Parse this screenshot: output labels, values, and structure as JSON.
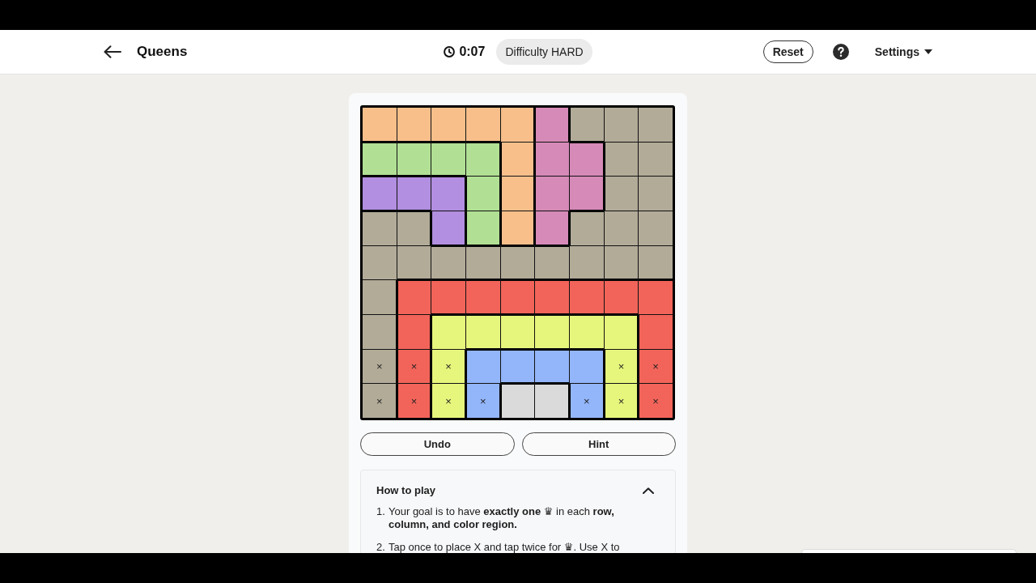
{
  "header": {
    "title": "Queens",
    "timer": "0:07",
    "difficulty": "Difficulty HARD",
    "reset": "Reset",
    "settings": "Settings"
  },
  "board": {
    "rows": [
      [
        {
          "color": "#f9bf8b"
        },
        {
          "color": "#f9bf8b"
        },
        {
          "color": "#f9bf8b"
        },
        {
          "color": "#f9bf8b"
        },
        {
          "color": "#f9bf8b"
        },
        {
          "color": "#d68ab8"
        },
        {
          "color": "#b2ab98"
        },
        {
          "color": "#b2ab98"
        },
        {
          "color": "#b2ab98"
        }
      ],
      [
        {
          "color": "#b1e095"
        },
        {
          "color": "#b1e095"
        },
        {
          "color": "#b1e095"
        },
        {
          "color": "#b1e095"
        },
        {
          "color": "#f9bf8b"
        },
        {
          "color": "#d68ab8"
        },
        {
          "color": "#d68ab8"
        },
        {
          "color": "#b2ab98"
        },
        {
          "color": "#b2ab98"
        }
      ],
      [
        {
          "color": "#b28fe0"
        },
        {
          "color": "#b28fe0"
        },
        {
          "color": "#b28fe0"
        },
        {
          "color": "#b1e095"
        },
        {
          "color": "#f9bf8b"
        },
        {
          "color": "#d68ab8"
        },
        {
          "color": "#d68ab8"
        },
        {
          "color": "#b2ab98"
        },
        {
          "color": "#b2ab98"
        }
      ],
      [
        {
          "color": "#b2ab98"
        },
        {
          "color": "#b2ab98"
        },
        {
          "color": "#b28fe0"
        },
        {
          "color": "#b1e095"
        },
        {
          "color": "#f9bf8b"
        },
        {
          "color": "#d68ab8"
        },
        {
          "color": "#b2ab98"
        },
        {
          "color": "#b2ab98"
        },
        {
          "color": "#b2ab98"
        }
      ],
      [
        {
          "color": "#b2ab98"
        },
        {
          "color": "#b2ab98"
        },
        {
          "color": "#b2ab98"
        },
        {
          "color": "#b2ab98"
        },
        {
          "color": "#b2ab98"
        },
        {
          "color": "#b2ab98"
        },
        {
          "color": "#b2ab98"
        },
        {
          "color": "#b2ab98"
        },
        {
          "color": "#b2ab98"
        }
      ],
      [
        {
          "color": "#b2ab98"
        },
        {
          "color": "#f2645a"
        },
        {
          "color": "#f2645a"
        },
        {
          "color": "#f2645a"
        },
        {
          "color": "#f2645a"
        },
        {
          "color": "#f2645a"
        },
        {
          "color": "#f2645a"
        },
        {
          "color": "#f2645a"
        },
        {
          "color": "#f2645a"
        }
      ],
      [
        {
          "color": "#b2ab98"
        },
        {
          "color": "#f2645a"
        },
        {
          "color": "#e6f67c"
        },
        {
          "color": "#e6f67c"
        },
        {
          "color": "#e6f67c"
        },
        {
          "color": "#e6f67c"
        },
        {
          "color": "#e6f67c"
        },
        {
          "color": "#e6f67c"
        },
        {
          "color": "#f2645a"
        }
      ],
      [
        {
          "color": "#b2ab98",
          "mark": "×"
        },
        {
          "color": "#f2645a",
          "mark": "×"
        },
        {
          "color": "#e6f67c",
          "mark": "×"
        },
        {
          "color": "#93b5fa"
        },
        {
          "color": "#93b5fa"
        },
        {
          "color": "#93b5fa"
        },
        {
          "color": "#93b5fa"
        },
        {
          "color": "#e6f67c",
          "mark": "×"
        },
        {
          "color": "#f2645a",
          "mark": "×"
        }
      ],
      [
        {
          "color": "#b2ab98",
          "mark": "×"
        },
        {
          "color": "#f2645a",
          "mark": "×"
        },
        {
          "color": "#e6f67c",
          "mark": "×"
        },
        {
          "color": "#93b5fa",
          "mark": "×"
        },
        {
          "color": "#dadada"
        },
        {
          "color": "#dadada"
        },
        {
          "color": "#93b5fa",
          "mark": "×"
        },
        {
          "color": "#e6f67c",
          "mark": "×"
        },
        {
          "color": "#f2645a",
          "mark": "×"
        }
      ]
    ]
  },
  "buttons": [
    "Undo",
    "Hint"
  ],
  "how_to_play": {
    "title": "How to play",
    "expanded": true,
    "steps": [
      {
        "number": "1.",
        "text": "Your goal is to have **exactly one** ♛ in each **row, column, and color region.**"
      },
      {
        "number": "2.",
        "text": "Tap once to place X and tap twice for ♛. Use X to"
      }
    ]
  }
}
